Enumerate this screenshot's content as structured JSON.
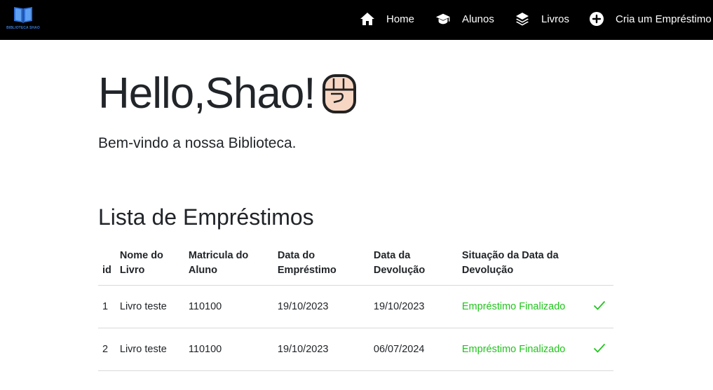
{
  "brand": {
    "logo_icon": "open-book-icon",
    "caption": "BIBLIOTECA SHAO"
  },
  "nav": {
    "items": [
      {
        "label": "Home",
        "icon": "house-icon"
      },
      {
        "label": "Alunos",
        "icon": "graduation-cap-icon"
      },
      {
        "label": "Livros",
        "icon": "layers-icon"
      },
      {
        "label": "Cria um Empréstimo",
        "icon": "plus-circle-icon"
      }
    ]
  },
  "hero": {
    "greeting": "Hello,Shao!",
    "greeting_icon": "raised-fist-icon",
    "subtitle": "Bem-vindo a nossa Biblioteca."
  },
  "loans": {
    "title": "Lista de Empréstimos",
    "columns": [
      "id",
      "Nome do Livro",
      "Matricula do Aluno",
      "Data do Empréstimo",
      "Data da Devolução",
      "Situação da Data da Devolução",
      ""
    ],
    "rows": [
      {
        "id": "1",
        "book": "Livro teste",
        "registration": "110100",
        "loan_date": "19/10/2023",
        "return_date": "19/10/2023",
        "status": "Empréstimo Finalizado",
        "status_icon": "checkmark-icon"
      },
      {
        "id": "2",
        "book": "Livro teste",
        "registration": "110100",
        "loan_date": "19/10/2023",
        "return_date": "06/07/2024",
        "status": "Empréstimo Finalizado",
        "status_icon": "checkmark-icon"
      }
    ]
  },
  "colors": {
    "navbar_bg": "#000000",
    "status_green": "#22c31e",
    "text": "#212529"
  }
}
